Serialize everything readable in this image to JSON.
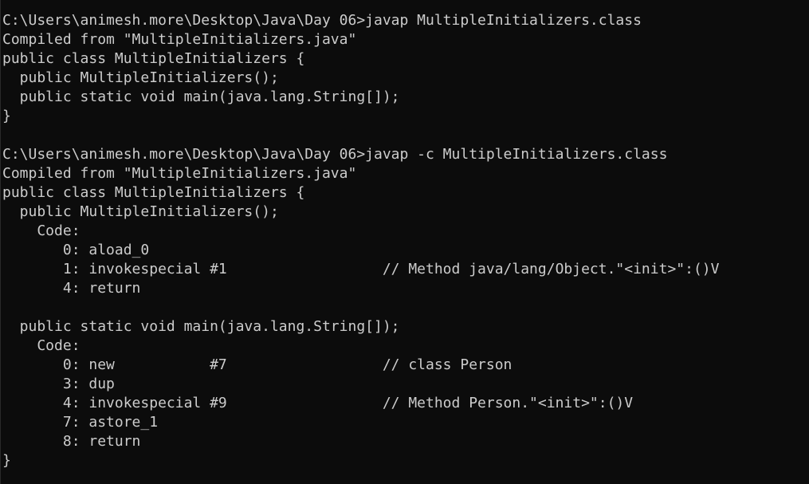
{
  "console": {
    "lines": [
      "C:\\Users\\animesh.more\\Desktop\\Java\\Day 06>javap MultipleInitializers.class",
      "Compiled from \"MultipleInitializers.java\"",
      "public class MultipleInitializers {",
      "  public MultipleInitializers();",
      "  public static void main(java.lang.String[]);",
      "}",
      "",
      "C:\\Users\\animesh.more\\Desktop\\Java\\Day 06>javap -c MultipleInitializers.class",
      "Compiled from \"MultipleInitializers.java\"",
      "public class MultipleInitializers {",
      "  public MultipleInitializers();",
      "    Code:",
      "       0: aload_0",
      "       1: invokespecial #1                  // Method java/lang/Object.\"<init>\":()V",
      "       4: return",
      "",
      "  public static void main(java.lang.String[]);",
      "    Code:",
      "       0: new           #7                  // class Person",
      "       3: dup",
      "       4: invokespecial #9                  // Method Person.\"<init>\":()V",
      "       7: astore_1",
      "       8: return",
      "}"
    ]
  }
}
